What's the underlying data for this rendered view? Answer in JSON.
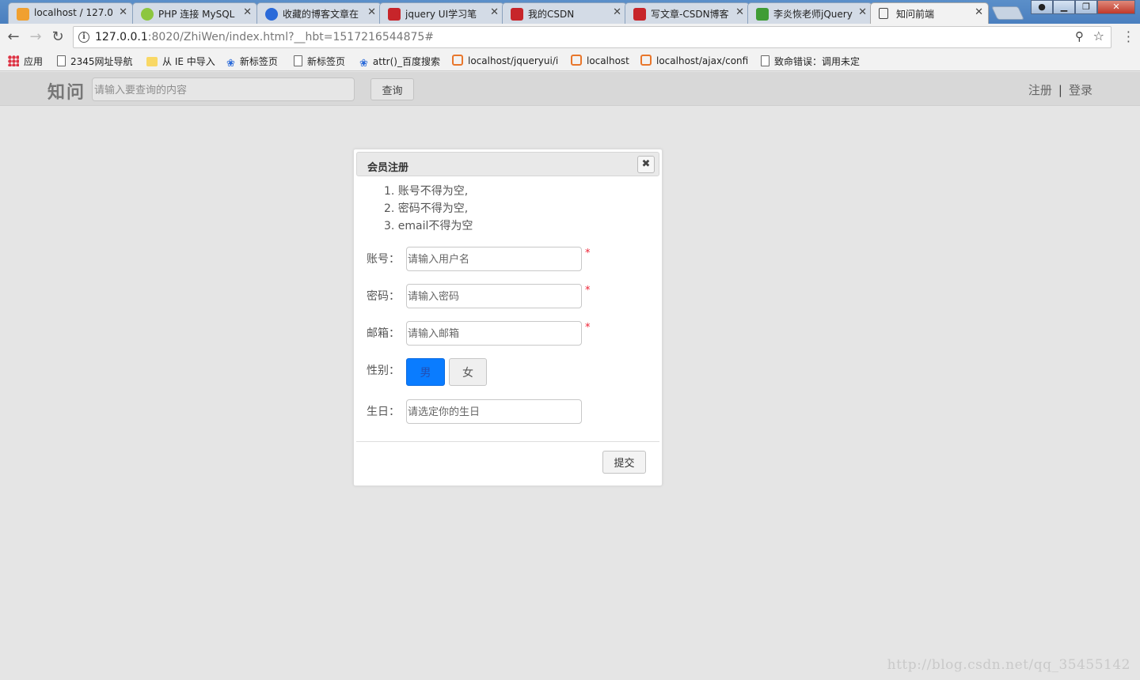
{
  "browser": {
    "tabs": [
      {
        "title": "localhost / 127.0",
        "icon": "phpmyadmin-icon",
        "color": "#e67e22"
      },
      {
        "title": "PHP 连接 MySQL",
        "icon": "php-icon",
        "color": "#8dc63f"
      },
      {
        "title": "收藏的博客文章在",
        "icon": "paw-icon",
        "color": "#2a6ad9"
      },
      {
        "title": "jquery UI学习笔",
        "icon": "csdn-icon",
        "color": "#c7252a"
      },
      {
        "title": "我的CSDN",
        "icon": "csdn-icon",
        "color": "#c7252a"
      },
      {
        "title": "写文章-CSDN博客",
        "icon": "csdn-icon",
        "color": "#c7252a"
      },
      {
        "title": "李炎恢老师jQuery",
        "icon": "book-icon",
        "color": "#3f9c35"
      },
      {
        "title": "知问前端",
        "icon": "page-icon",
        "color": "#444444"
      }
    ],
    "active_tab": 7,
    "url_host": "127.0.0.1",
    "url_rest": ":8020/ZhiWen/index.html?__hbt=1517216544875#",
    "bookmarks": [
      {
        "label": "应用",
        "icon": "apps-icon"
      },
      {
        "label": "2345网址导航",
        "icon": "page-icon"
      },
      {
        "label": "从 IE 中导入",
        "icon": "folder-icon"
      },
      {
        "label": "新标签页",
        "icon": "paw-icon"
      },
      {
        "label": "新标签页",
        "icon": "page-icon"
      },
      {
        "label": "attr()_百度搜索",
        "icon": "paw-icon"
      },
      {
        "label": "localhost/jqueryui/i",
        "icon": "xampp-icon"
      },
      {
        "label": "localhost",
        "icon": "xampp-icon"
      },
      {
        "label": "localhost/ajax/confi",
        "icon": "xampp-icon"
      },
      {
        "label": "致命错误：调用未定",
        "icon": "page-icon"
      }
    ]
  },
  "header": {
    "logo": "知问",
    "search_placeholder": "请输入要查询的内容",
    "search_button": "查询",
    "register_link": "注册",
    "separator": "|",
    "login_link": "登录"
  },
  "dialog": {
    "title": "会员注册",
    "close_symbol": "✖",
    "rules": [
      "1. 账号不得为空,",
      "2. 密码不得为空,",
      "3. email不得为空"
    ],
    "fields": {
      "username": {
        "label": "账号：",
        "placeholder": "请输入用户名",
        "required": "*"
      },
      "password": {
        "label": "密码：",
        "placeholder": "请输入密码",
        "required": "*"
      },
      "email": {
        "label": "邮箱：",
        "placeholder": "请输入邮箱",
        "required": "*"
      },
      "gender": {
        "label": "性别：",
        "options": [
          "男",
          "女"
        ],
        "selected": "男"
      },
      "birthday": {
        "label": "生日：",
        "placeholder": "请选定你的生日"
      }
    },
    "submit": "提交"
  },
  "watermark": "http://blog.csdn.net/qq_35455142",
  "colors": {
    "accent": "#0a7cff",
    "required": "#e22233",
    "page_bg": "#e5e5e5",
    "header_bg": "#d8d8d8"
  }
}
